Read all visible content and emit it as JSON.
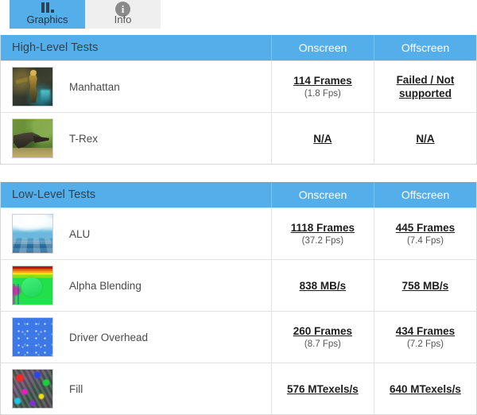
{
  "tabs": [
    {
      "label": "Graphics",
      "icon": "bar-chart-icon",
      "active": true
    },
    {
      "label": "Info",
      "icon": "info-circle-icon",
      "active": false
    }
  ],
  "colors": {
    "header_blue": "#54aeea",
    "header_title_text": "#32434f",
    "row_border": "#e2e2e2"
  },
  "tables": [
    {
      "title": "High-Level Tests",
      "columns": [
        "Onscreen",
        "Offscreen"
      ],
      "rows": [
        {
          "name": "Manhattan",
          "thumb": "manhattan-thumbnail",
          "onscreen": {
            "main": "114 Frames",
            "sub": "(1.8 Fps)"
          },
          "offscreen": {
            "main": "Failed / Not supported",
            "sub": ""
          }
        },
        {
          "name": "T-Rex",
          "thumb": "trex-thumbnail",
          "onscreen": {
            "main": "N/A",
            "sub": ""
          },
          "offscreen": {
            "main": "N/A",
            "sub": ""
          }
        }
      ]
    },
    {
      "title": "Low-Level Tests",
      "columns": [
        "Onscreen",
        "Offscreen"
      ],
      "rows": [
        {
          "name": "ALU",
          "thumb": "alu-thumbnail",
          "onscreen": {
            "main": "1118 Frames",
            "sub": "(37.2 Fps)"
          },
          "offscreen": {
            "main": "445 Frames",
            "sub": "(7.4 Fps)"
          }
        },
        {
          "name": "Alpha Blending",
          "thumb": "alpha-blending-thumbnail",
          "onscreen": {
            "main": "838 MB/s",
            "sub": ""
          },
          "offscreen": {
            "main": "758 MB/s",
            "sub": ""
          }
        },
        {
          "name": "Driver Overhead",
          "thumb": "driver-overhead-thumbnail",
          "onscreen": {
            "main": "260 Frames",
            "sub": "(8.7 Fps)"
          },
          "offscreen": {
            "main": "434 Frames",
            "sub": "(7.2 Fps)"
          }
        },
        {
          "name": "Fill",
          "thumb": "fill-thumbnail",
          "onscreen": {
            "main": "576 MTexels/s",
            "sub": ""
          },
          "offscreen": {
            "main": "640 MTexels/s",
            "sub": ""
          }
        }
      ]
    }
  ]
}
